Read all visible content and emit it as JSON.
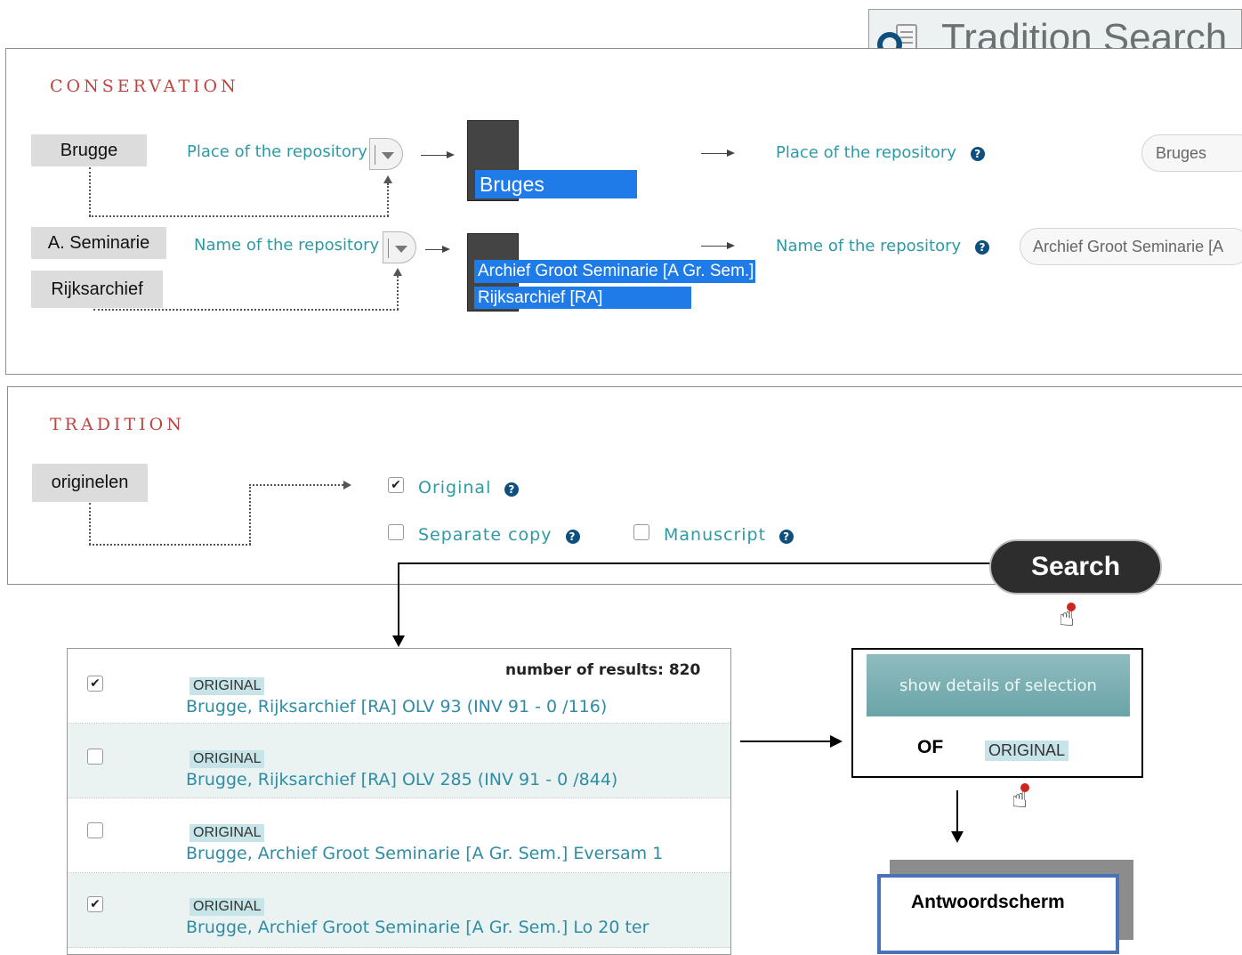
{
  "header": {
    "title": "Tradition Search",
    "icon": "search-scroll-icon"
  },
  "conservation": {
    "title": "CONSERVATION",
    "labels": {
      "brugge": "Brugge",
      "seminarie": "A. Seminarie",
      "rijksarchief": "Rijksarchief"
    },
    "place_label": "Place of the repository",
    "name_label": "Name of the repository",
    "selected_place": "Bruges",
    "selected_names": [
      "Archief Groot Seminarie [A Gr. Sem.]",
      "Rijksarchief [RA]"
    ],
    "place_field_value": "Bruges",
    "name_field_value": "Archief Groot Seminarie [A"
  },
  "tradition": {
    "title": "TRADITION",
    "label": "originelen",
    "options": [
      {
        "label": "Original",
        "checked": true
      },
      {
        "label": "Separate copy",
        "checked": false
      },
      {
        "label": "Manuscript",
        "checked": false
      }
    ]
  },
  "search_button": "Search",
  "results": {
    "count_text": "number of results: 820",
    "rows": [
      {
        "checked": true,
        "badge": "ORIGINAL",
        "link": "Brugge, Rijksarchief [RA] OLV 93 (INV 91 - 0 /116)"
      },
      {
        "checked": false,
        "badge": "ORIGINAL",
        "link": "Brugge, Rijksarchief [RA] OLV 285 (INV 91 - 0 /844)"
      },
      {
        "checked": false,
        "badge": "ORIGINAL",
        "link": "Brugge, Archief Groot Seminarie [A Gr. Sem.] Eversam 1"
      },
      {
        "checked": true,
        "badge": "ORIGINAL",
        "link": "Brugge, Archief Groot Seminarie [A Gr. Sem.] Lo 20 ter"
      }
    ]
  },
  "details": {
    "button": "show details of selection",
    "of_text": "OF",
    "badge": "ORIGINAL"
  },
  "answer_screen": "Antwoordscherm",
  "colors": {
    "section_title": "#c0443f",
    "link_teal": "#2e9aa3",
    "selection_blue": "#1f7be8",
    "help_icon": "#0d4f7d"
  }
}
